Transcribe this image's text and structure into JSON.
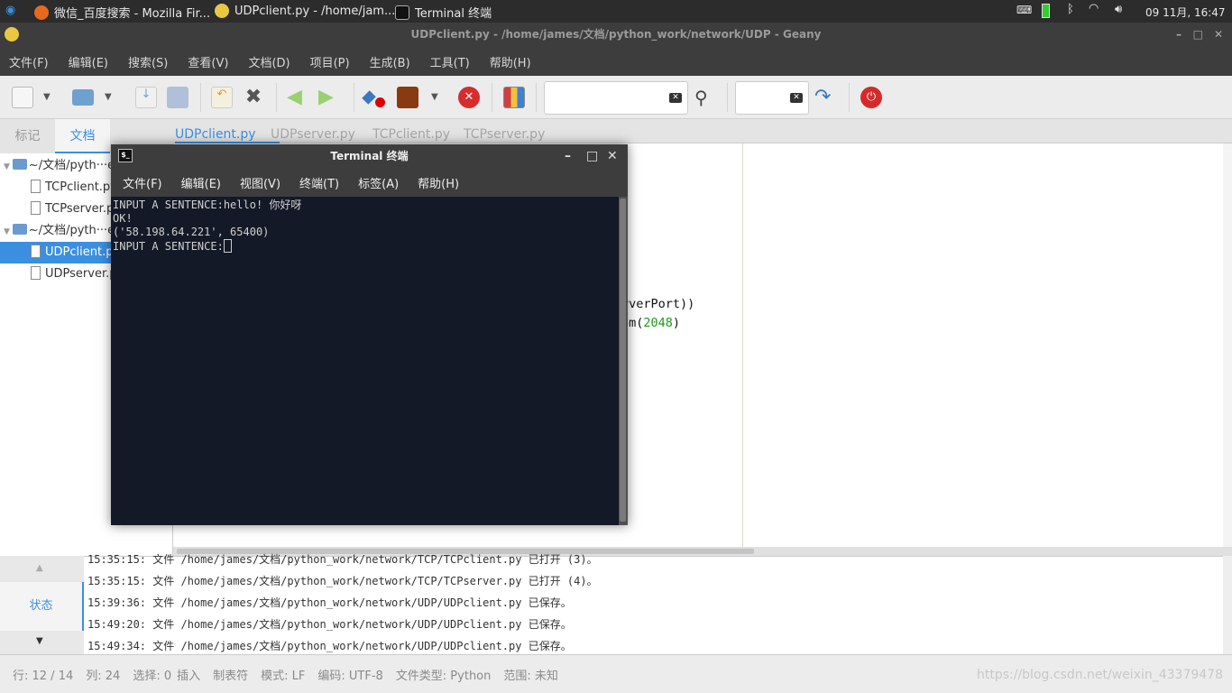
{
  "taskbar": {
    "tasks": [
      "微信_百度搜索 - Mozilla Fir...",
      "UDPclient.py - /home/jam...",
      "Terminal 终端"
    ],
    "clock": "09 11月, 16:47"
  },
  "window": {
    "title": "UDPclient.py - /home/james/文档/python_work/network/UDP - Geany"
  },
  "menu": [
    "文件(F)",
    "编辑(E)",
    "搜索(S)",
    "查看(V)",
    "文档(D)",
    "项目(P)",
    "生成(B)",
    "工具(T)",
    "帮助(H)"
  ],
  "toolbar": {
    "search_value": "",
    "goto_value": ""
  },
  "sidebar": {
    "tabs": [
      "标记",
      "文档"
    ],
    "active_tab": "文档",
    "tree": [
      {
        "type": "folder",
        "label": "~/文档/pyth···et"
      },
      {
        "type": "file",
        "label": "TCPclient.py"
      },
      {
        "type": "file",
        "label": "TCPserver.py"
      },
      {
        "type": "folder",
        "label": "~/文档/pyth···et"
      },
      {
        "type": "file",
        "label": "UDPclient.py",
        "selected": true
      },
      {
        "type": "file",
        "label": "UDPserver.py"
      }
    ]
  },
  "editor": {
    "tabs": [
      "UDPclient.py",
      "UDPserver.py",
      "TCPclient.py",
      "TCPserver.py"
    ],
    "active_tab": "UDPclient.py",
    "visible_code": [
      "rverPort))",
      "om(",
      "2048",
      ")"
    ]
  },
  "messages": {
    "side_label": "状态",
    "lines": [
      "15:35:15: 文件 /home/james/文档/python_work/network/TCP/TCPclient.py 已打开 (3)。",
      "15:35:15: 文件 /home/james/文档/python_work/network/TCP/TCPserver.py 已打开 (4)。",
      "15:39:36: 文件 /home/james/文档/python_work/network/UDP/UDPclient.py 已保存。",
      "15:49:20: 文件 /home/james/文档/python_work/network/UDP/UDPclient.py 已保存。",
      "15:49:34: 文件 /home/james/文档/python_work/network/UDP/UDPclient.py 已保存。"
    ]
  },
  "status": [
    "行: 12 / 14",
    "列: 24",
    "选择: 0",
    "插入",
    "制表符",
    "模式: LF",
    "编码: UTF-8",
    "文件类型: Python",
    "范围: 未知"
  ],
  "watermark": "https://blog.csdn.net/weixin_43379478",
  "terminal": {
    "title": "Terminal 终端",
    "menu": [
      "文件(F)",
      "编辑(E)",
      "视图(V)",
      "终端(T)",
      "标签(A)",
      "帮助(H)"
    ],
    "lines": [
      "INPUT A SENTENCE:hello! 你好呀",
      "OK!",
      "('58.198.64.221', 65400)",
      "INPUT A SENTENCE:"
    ]
  },
  "colors": {
    "accent": "#3c8fe0",
    "terminal_bg": "#131926",
    "number": "#1a9a1a"
  }
}
